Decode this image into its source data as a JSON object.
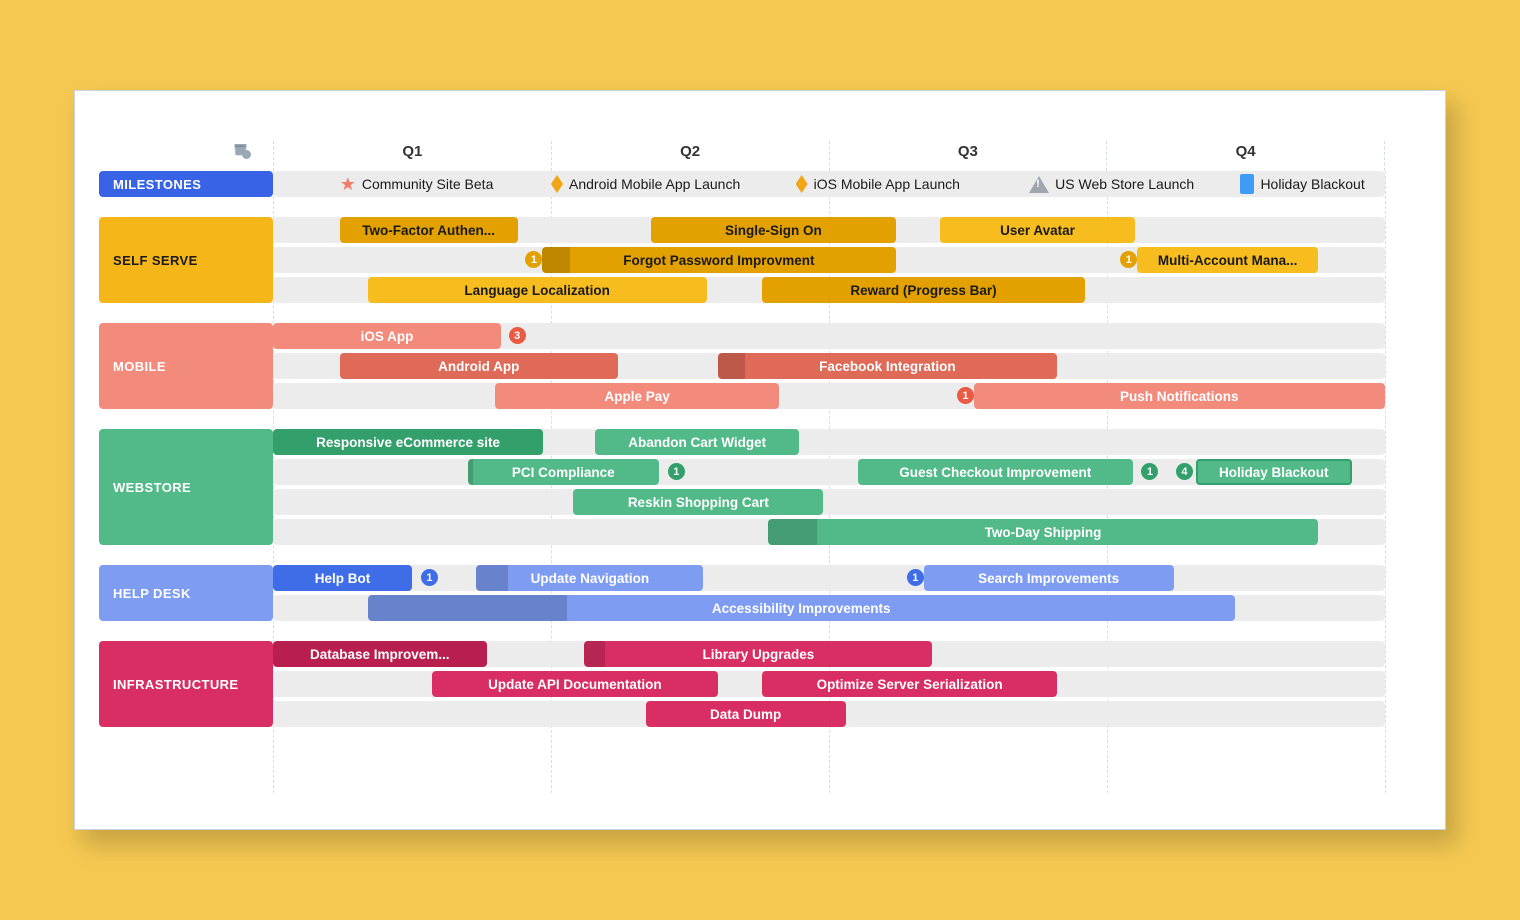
{
  "quarters": [
    "Q1",
    "Q2",
    "Q3",
    "Q4"
  ],
  "milestones_label": "MILESTONES",
  "milestones": [
    {
      "icon": "star",
      "label": "Community Site Beta",
      "pos": 6
    },
    {
      "icon": "diamond",
      "label": "Android Mobile App Launch",
      "pos": 25
    },
    {
      "icon": "diamond",
      "label": "iOS Mobile App Launch",
      "pos": 47
    },
    {
      "icon": "warn",
      "label": "US Web Store Launch",
      "pos": 68
    },
    {
      "icon": "square",
      "label": "Holiday Blackout",
      "pos": 87
    }
  ],
  "lanes": [
    {
      "id": "self-serve",
      "label": "SELF SERVE",
      "color": "#f5b619",
      "text": "#1a1a1a",
      "rows": [
        [
          {
            "label": "Two-Factor Authen...",
            "start": 6,
            "end": 22,
            "bg": "#e3a100",
            "fg": "#1a1a1a"
          },
          {
            "label": "Single-Sign On",
            "start": 34,
            "end": 56,
            "bg": "#e3a100",
            "fg": "#1a1a1a"
          },
          {
            "label": "User Avatar",
            "start": 60,
            "end": 77.5,
            "bg": "#f7bd1f",
            "fg": "#1a1a1a"
          }
        ],
        [
          {
            "badge": "1",
            "badge_bg": "#e3a100",
            "badge_at": 22.7
          },
          {
            "label": "Forgot Password Improvment",
            "start": 24.2,
            "end": 56,
            "bg": "#e3a100",
            "fg": "#1a1a1a",
            "dark": 8
          },
          {
            "badge": "1",
            "badge_bg": "#e3a100",
            "badge_at": 76.2
          },
          {
            "label": "Multi-Account Mana...",
            "start": 77.7,
            "end": 94,
            "bg": "#f7bd1f",
            "fg": "#1a1a1a"
          }
        ],
        [
          {
            "label": "Language Localization",
            "start": 8.5,
            "end": 39,
            "bg": "#f7bd1f",
            "fg": "#1a1a1a"
          },
          {
            "label": "Reward (Progress Bar)",
            "start": 44,
            "end": 73,
            "bg": "#e3a100",
            "fg": "#1a1a1a"
          }
        ]
      ]
    },
    {
      "id": "mobile",
      "label": "MOBILE",
      "color": "#f38b7d",
      "text": "#fff",
      "rows": [
        [
          {
            "label": "iOS App",
            "start": 0,
            "end": 20.5,
            "bg": "#f38b7d",
            "fg": "#fff"
          },
          {
            "badge": "3",
            "badge_bg": "#e95b45",
            "badge_at": 21.2
          }
        ],
        [
          {
            "label": "Android App",
            "start": 6,
            "end": 31,
            "bg": "#e06a58",
            "fg": "#fff"
          },
          {
            "label": "Facebook Integration",
            "start": 40,
            "end": 70.5,
            "bg": "#e06a58",
            "fg": "#fff",
            "dark": 8
          }
        ],
        [
          {
            "label": "Apple Pay",
            "start": 20,
            "end": 45.5,
            "bg": "#f38b7d",
            "fg": "#fff"
          },
          {
            "badge": "1",
            "badge_bg": "#e95b45",
            "badge_at": 61.5
          },
          {
            "label": "Push Notifications",
            "start": 63,
            "end": 100,
            "bg": "#f38b7d",
            "fg": "#fff"
          }
        ]
      ]
    },
    {
      "id": "webstore",
      "label": "WEBSTORE",
      "color": "#52ba88",
      "text": "#fff",
      "rows": [
        [
          {
            "label": "Responsive eCommerce site",
            "start": 0,
            "end": 24.3,
            "bg": "#33a06c",
            "fg": "#fff"
          },
          {
            "label": "Abandon Cart Widget",
            "start": 29,
            "end": 47.3,
            "bg": "#52ba88",
            "fg": "#fff"
          }
        ],
        [
          {
            "label": "PCI Compliance",
            "start": 17.5,
            "end": 34.7,
            "bg": "#52ba88",
            "fg": "#fff",
            "dark": 3
          },
          {
            "badge": "1",
            "badge_bg": "#33a06c",
            "badge_at": 35.5
          },
          {
            "label": "Guest Checkout Improvement",
            "start": 52.6,
            "end": 77.3,
            "bg": "#52ba88",
            "fg": "#fff"
          },
          {
            "badge": "1",
            "badge_bg": "#33a06c",
            "badge_at": 78.1
          },
          {
            "badge": "4",
            "badge_bg": "#33a06c",
            "badge_at": 81.2
          },
          {
            "label": "Holiday Blackout",
            "start": 83,
            "end": 97,
            "bg": "#52ba88",
            "fg": "#fff",
            "outline": "#33a06c"
          }
        ],
        [
          {
            "label": "Reskin Shopping Cart",
            "start": 27,
            "end": 49.5,
            "bg": "#52ba88",
            "fg": "#fff"
          }
        ],
        [
          {
            "label": "Two-Day Shipping",
            "start": 44.5,
            "end": 94,
            "bg": "#52ba88",
            "fg": "#fff",
            "dark": 9
          }
        ]
      ]
    },
    {
      "id": "help-desk",
      "label": "HELP DESK",
      "color": "#7d9cf2",
      "text": "#fff",
      "rows": [
        [
          {
            "label": "Help Bot",
            "start": 0,
            "end": 12.5,
            "bg": "#3f6de8",
            "fg": "#fff"
          },
          {
            "badge": "1",
            "badge_bg": "#3f6de8",
            "badge_at": 13.3
          },
          {
            "label": "Update Navigation",
            "start": 18.3,
            "end": 38.7,
            "bg": "#7d9cf2",
            "fg": "#fff",
            "dark": 14
          },
          {
            "badge": "1",
            "badge_bg": "#3f6de8",
            "badge_at": 57
          },
          {
            "label": "Search Improvements",
            "start": 58.5,
            "end": 81,
            "bg": "#7d9cf2",
            "fg": "#fff"
          }
        ],
        [
          {
            "label": "Accessibility Improvements",
            "start": 8.5,
            "end": 86.5,
            "bg": "#7d9cf2",
            "fg": "#fff",
            "dark": 23
          }
        ]
      ]
    },
    {
      "id": "infrastructure",
      "label": "INFRASTRUCTURE",
      "color": "#d92e63",
      "text": "#fff",
      "rows": [
        [
          {
            "label": "Database Improvem...",
            "start": 0,
            "end": 19.2,
            "bg": "#b91f4e",
            "fg": "#fff"
          },
          {
            "label": "Library Upgrades",
            "start": 28,
            "end": 59.3,
            "bg": "#d92e63",
            "fg": "#fff",
            "dark": 6
          }
        ],
        [
          {
            "label": "Update API Documentation",
            "start": 14.3,
            "end": 40,
            "bg": "#d92e63",
            "fg": "#fff"
          },
          {
            "label": "Optimize Server Serialization",
            "start": 44,
            "end": 70.5,
            "bg": "#d92e63",
            "fg": "#fff"
          }
        ],
        [
          {
            "label": "Data Dump",
            "start": 33.5,
            "end": 51.5,
            "bg": "#d92e63",
            "fg": "#fff"
          }
        ]
      ]
    }
  ],
  "lane_colors": {
    "MILESTONES": "#3963e6"
  }
}
